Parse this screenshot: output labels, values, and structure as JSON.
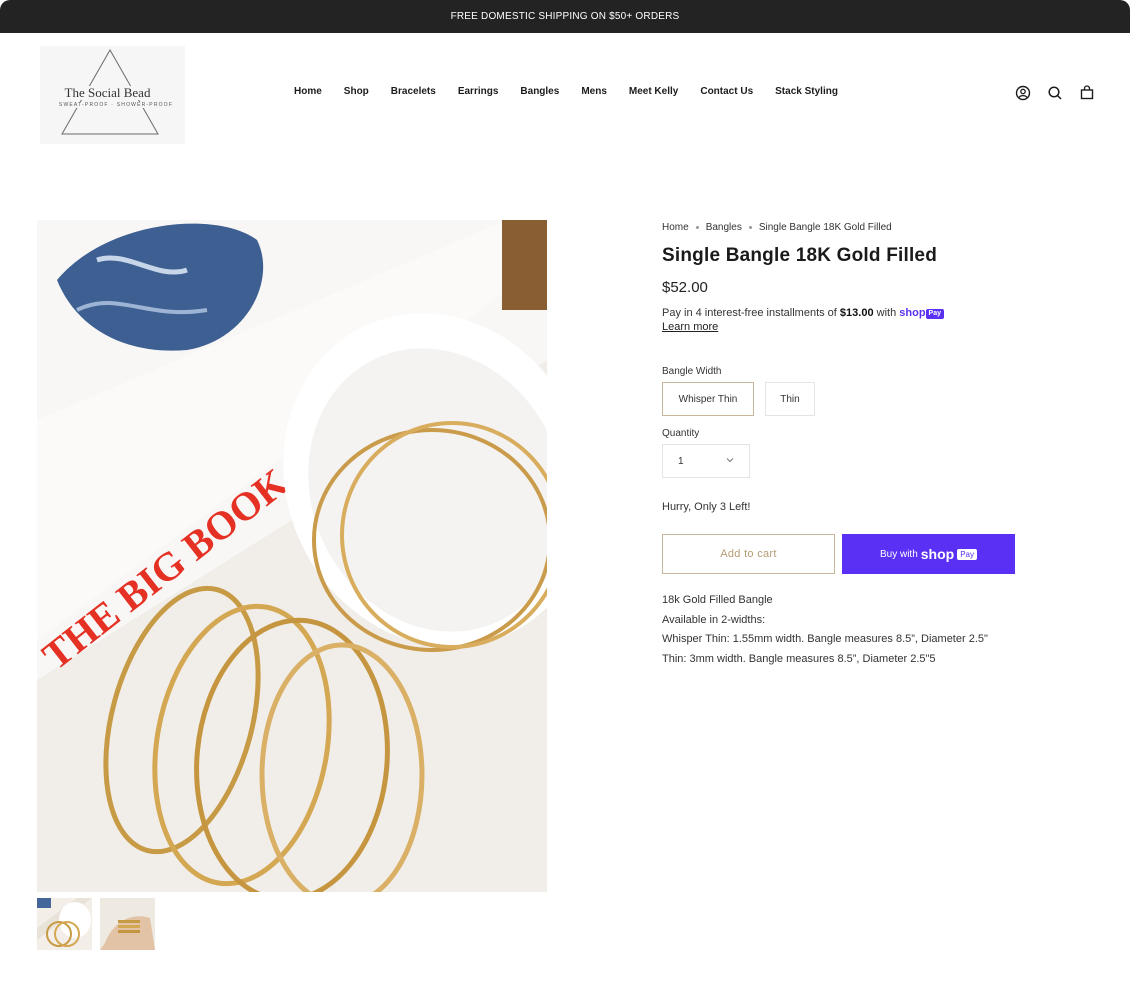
{
  "announcement": {
    "text": "FREE DOMESTIC SHIPPING ON $50+ ORDERS"
  },
  "logo": {
    "name": "The Social Bead",
    "tagline": "SWEAT-PROOF · SHOWER-PROOF"
  },
  "nav": {
    "items": [
      {
        "label": "Home"
      },
      {
        "label": "Shop"
      },
      {
        "label": "Bracelets"
      },
      {
        "label": "Earrings"
      },
      {
        "label": "Bangles"
      },
      {
        "label": "Mens"
      },
      {
        "label": "Meet Kelly"
      },
      {
        "label": "Contact Us"
      },
      {
        "label": "Stack Styling"
      }
    ]
  },
  "header_icons": [
    "account-icon",
    "search-icon",
    "cart-icon"
  ],
  "breadcrumb": [
    "Home",
    "Bangles",
    "Single Bangle 18K Gold Filled"
  ],
  "product": {
    "title": "Single Bangle 18K Gold Filled",
    "price": "$52.00",
    "installments_prefix": "Pay in 4 interest-free installments of",
    "installments_amount": "$13.00",
    "installments_with": "with",
    "shop_word": "shop",
    "pay_badge": "Pay",
    "learn_more": "Learn more",
    "width_label": "Bangle Width",
    "width_options": [
      "Whisper Thin",
      "Thin"
    ],
    "selected_width": "Whisper Thin",
    "quantity_label": "Quantity",
    "quantity": "1",
    "stock_notice": "Hurry, Only 3 Left!",
    "add_to_cart": "Add to cart",
    "buy_with": "Buy with",
    "description": [
      "18k Gold Filled Bangle",
      "Available in 2-widths:",
      "Whisper Thin: 1.55mm width. Bangle measures 8.5”, Diameter 2.5\"",
      "Thin: 3mm width. Bangle measures 8.5”, Diameter 2.5\"5"
    ]
  },
  "colors": {
    "shop_pay": "#5a31f4",
    "accent_gold": "#c8b79a",
    "announcement_bg": "#232323"
  }
}
